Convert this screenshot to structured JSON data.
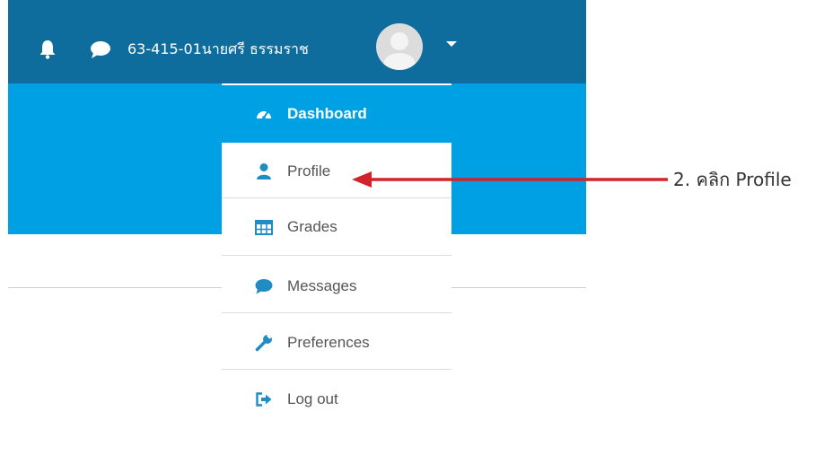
{
  "navbar": {
    "user_name": "63-415-01นายศรี ธรรมราช",
    "icons": {
      "notifications": "bell-icon",
      "messages": "chat-bubble-icon",
      "menu_toggle": "caret-down-icon"
    }
  },
  "user_menu": {
    "items": [
      {
        "label": "Dashboard",
        "icon": "dashboard-gauge-icon",
        "active": true
      },
      {
        "label": "Profile",
        "icon": "user-icon"
      },
      {
        "label": "Grades",
        "icon": "table-grid-icon"
      },
      {
        "label": "Messages",
        "icon": "chat-bubble-icon"
      },
      {
        "label": "Preferences",
        "icon": "wrench-icon"
      },
      {
        "label": "Log out",
        "icon": "sign-out-icon"
      }
    ]
  },
  "annotation": {
    "label": "2. คลิก Profile"
  },
  "colors": {
    "navbar": "#0e6d9d",
    "accent": "#00a0e4",
    "menu_icon": "#1f8dc4",
    "arrow": "#d1232a",
    "text": "#555555"
  }
}
